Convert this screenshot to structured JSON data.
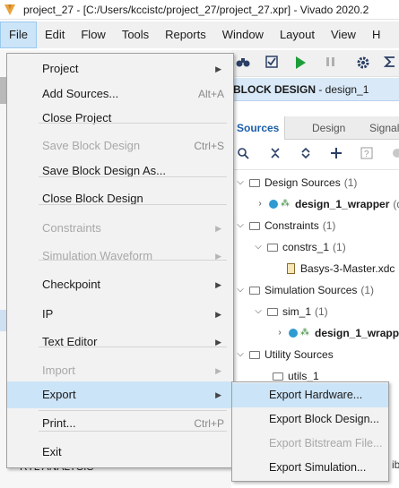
{
  "window": {
    "title": "project_27 - [C:/Users/kccistc/project_27/project_27.xpr] - Vivado 2020.2"
  },
  "menubar": [
    {
      "label": "File",
      "active": true
    },
    {
      "label": "Edit"
    },
    {
      "label": "Flow"
    },
    {
      "label": "Tools"
    },
    {
      "label": "Reports"
    },
    {
      "label": "Window"
    },
    {
      "label": "Layout"
    },
    {
      "label": "View"
    },
    {
      "label": "H"
    }
  ],
  "file_menu": {
    "items": [
      {
        "label": "Project",
        "submenu": true,
        "enabled": true
      },
      {
        "label": "Add Sources...",
        "shortcut": "Alt+A",
        "enabled": true
      },
      {
        "label": "Close Project",
        "enabled": true
      },
      {
        "label": "Save Block Design",
        "shortcut": "Ctrl+S",
        "enabled": false
      },
      {
        "label": "Save Block Design As...",
        "enabled": true
      },
      {
        "label": "Close Block Design",
        "enabled": true
      },
      {
        "label": "Constraints",
        "submenu": true,
        "enabled": false
      },
      {
        "label": "Simulation Waveform",
        "submenu": true,
        "enabled": false
      },
      {
        "label": "Checkpoint",
        "submenu": true,
        "enabled": true
      },
      {
        "label": "IP",
        "submenu": true,
        "enabled": true
      },
      {
        "label": "Text Editor",
        "submenu": true,
        "enabled": true
      },
      {
        "label": "Import",
        "submenu": true,
        "enabled": false
      },
      {
        "label": "Export",
        "submenu": true,
        "enabled": true,
        "highlighted": true
      },
      {
        "label": "Print...",
        "shortcut": "Ctrl+P",
        "enabled": true
      },
      {
        "label": "Exit",
        "enabled": true
      }
    ]
  },
  "export_submenu": {
    "items": [
      {
        "label": "Export Hardware...",
        "enabled": true,
        "highlighted": true
      },
      {
        "label": "Export Block Design...",
        "enabled": true
      },
      {
        "label": "Export Bitstream File...",
        "enabled": false
      },
      {
        "label": "Export Simulation...",
        "enabled": true
      }
    ]
  },
  "block_design_header": {
    "prefix": "BLOCK DESIGN",
    "suffix": " - design_1"
  },
  "tabs": [
    "Sources",
    "Design",
    "Signals"
  ],
  "sources_tree": {
    "design_sources": {
      "label": "Design Sources",
      "count": "(1)"
    },
    "design_1_wrapper": {
      "label": "design_1_wrapper",
      "suffix": "(d"
    },
    "constraints": {
      "label": "Constraints",
      "count": "(1)"
    },
    "constrs_1": {
      "label": "constrs_1",
      "count": "(1)"
    },
    "xdc_file": {
      "label": "Basys-3-Master.xdc"
    },
    "simulation_sources": {
      "label": "Simulation Sources",
      "count": "(1)"
    },
    "sim_1": {
      "label": "sim_1",
      "count": "(1)"
    },
    "sim_wrapper": {
      "label": "design_1_wrapp"
    },
    "utility_sources": {
      "label": "Utility Sources"
    },
    "utils_1": {
      "label": "utils_1"
    }
  },
  "left_pane": {
    "partial_label": "RTL ANALYSIS"
  },
  "partial_right_text": "ibi",
  "icons": {
    "logo": "vivado-logo-icon",
    "submenu_arrow": "▶"
  },
  "colors": {
    "highlight": "#cce4f7",
    "menu_bg": "#f2f2f2",
    "accent_blue": "#1a5ea8",
    "header_bg": "#d9e9f7"
  }
}
